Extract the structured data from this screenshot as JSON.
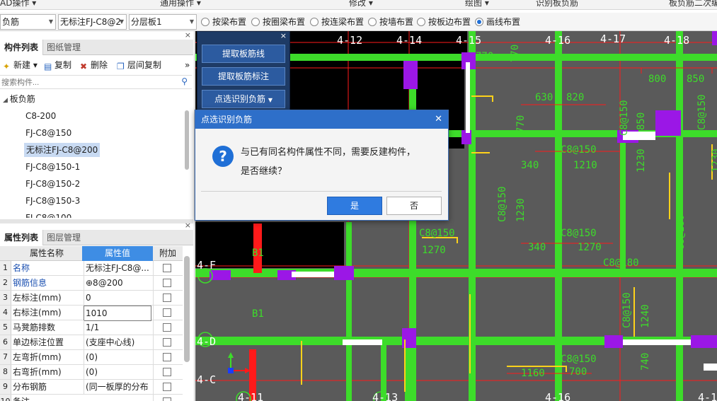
{
  "menubar": {
    "items": [
      "AD操作 ▾",
      "通用操作 ▾",
      "修改 ▾",
      "绘图 ▾",
      "识别板负筋",
      "板负筋二次编辑"
    ]
  },
  "toolbar": {
    "combo1": "负筋",
    "combo2": "无标注FJ-C8@2",
    "combo3": "分层板1",
    "radios": [
      {
        "label": "按梁布置",
        "checked": false
      },
      {
        "label": "按圈梁布置",
        "checked": false
      },
      {
        "label": "按连梁布置",
        "checked": false
      },
      {
        "label": "按墙布置",
        "checked": false
      },
      {
        "label": "按板边布置",
        "checked": false
      },
      {
        "label": "画线布置",
        "checked": true
      }
    ]
  },
  "component_panel": {
    "tab_active": "构件列表",
    "tab_inactive": "图纸管理",
    "new_label": "新建",
    "copy_label": "复制",
    "delete_label": "删除",
    "floorcopy_label": "层间复制",
    "search_placeholder": "搜索构件...",
    "tree_root": "板负筋",
    "tree_items": [
      "C8-200",
      "FJ-C8@150",
      "无标注FJ-C8@200",
      "FJ-C8@150-1",
      "FJ-C8@150-2",
      "FJ-C8@150-3",
      "FJ-C8@100"
    ]
  },
  "property_panel": {
    "tab_active": "属性列表",
    "tab_inactive": "图层管理",
    "col_name": "属性名称",
    "col_value": "属性值",
    "col_add": "附加",
    "rows": [
      {
        "n": "1",
        "name": "名称",
        "value": "无标注FJ-C8@...",
        "blue": true
      },
      {
        "n": "2",
        "name": "钢筋信息",
        "value": "⊕8@200",
        "blue": true
      },
      {
        "n": "3",
        "name": "左标注(mm)",
        "value": "0",
        "blue": false
      },
      {
        "n": "4",
        "name": "右标注(mm)",
        "value": "1010",
        "blue": false
      },
      {
        "n": "5",
        "name": "马凳筋排数",
        "value": "1/1",
        "blue": false
      },
      {
        "n": "6",
        "name": "单边标注位置",
        "value": "(支座中心线)",
        "blue": false
      },
      {
        "n": "7",
        "name": "左弯折(mm)",
        "value": "(0)",
        "blue": false
      },
      {
        "n": "8",
        "name": "右弯折(mm)",
        "value": "(0)",
        "blue": false
      },
      {
        "n": "9",
        "name": "分布钢筋",
        "value": "(同一板厚的分布",
        "blue": false
      },
      {
        "n": "10",
        "name": "备注",
        "value": "",
        "blue": false
      }
    ]
  },
  "float_panel": {
    "btn1": "提取板筋线",
    "btn2": "提取板筋标注",
    "btn3": "点选识别负筋"
  },
  "dialog": {
    "title": "点选识别负筋",
    "line1": "与已有同名构件属性不同，需要反建构件，",
    "line2": "是否继续？",
    "yes": "是",
    "no": "否"
  },
  "canvas": {
    "axis_labels": [
      "4-12",
      "4-14",
      "4-15",
      "4-16",
      "4-17",
      "4-18",
      "4-F",
      "4-D",
      "4-C",
      "4-11",
      "4-13",
      "4-16",
      "4-1"
    ],
    "dims": [
      "770",
      "770",
      "800",
      "850",
      "630",
      "820",
      "C8@150",
      "850",
      "C8@150",
      "1210",
      "1230",
      "770",
      "C8@150",
      "C8@150",
      "1210",
      "C8@180",
      "C8@150",
      "1240",
      "C8@150",
      "700",
      "1160",
      "740",
      "B1",
      "B1",
      "1230",
      "1270",
      "C8@150",
      "340",
      "1230"
    ]
  },
  "colors": {
    "canvas_bg": "#5a5a5a",
    "beam_green": "#3ddc2a",
    "purple": "#9b17e6",
    "red": "#ff1a1a",
    "yellow": "#ffd21a",
    "accent": "#2e6fc9"
  }
}
